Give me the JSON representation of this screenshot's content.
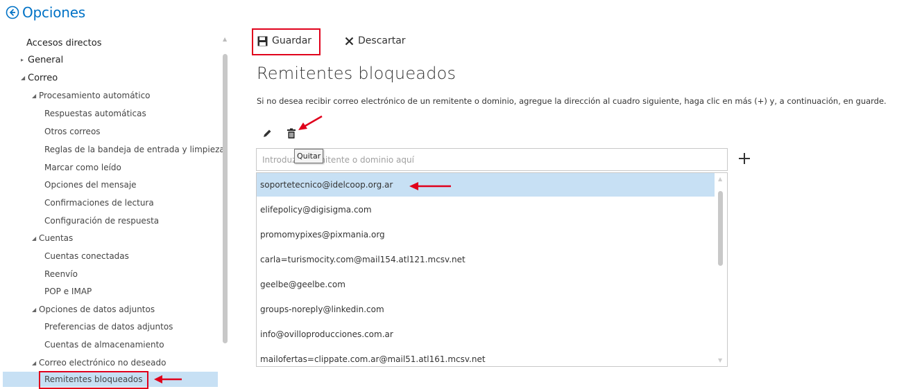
{
  "header": {
    "title": "Opciones",
    "back_icon": "back-arrow-circle-icon"
  },
  "sidebar": {
    "items": [
      {
        "label": "Accesos directos"
      },
      {
        "label": "General"
      },
      {
        "label": "Correo"
      },
      {
        "label": "Procesamiento automático"
      },
      {
        "label": "Respuestas automáticas"
      },
      {
        "label": "Otros correos"
      },
      {
        "label": "Reglas de la bandeja de entrada y limpieza"
      },
      {
        "label": "Marcar como leído"
      },
      {
        "label": "Opciones del mensaje"
      },
      {
        "label": "Confirmaciones de lectura"
      },
      {
        "label": "Configuración de respuesta"
      },
      {
        "label": "Cuentas"
      },
      {
        "label": "Cuentas conectadas"
      },
      {
        "label": "Reenvío"
      },
      {
        "label": "POP e IMAP"
      },
      {
        "label": "Opciones de datos adjuntos"
      },
      {
        "label": "Preferencias de datos adjuntos"
      },
      {
        "label": "Cuentas de almacenamiento"
      },
      {
        "label": "Correo electrónico no deseado"
      },
      {
        "label": "Remitentes bloqueados"
      }
    ],
    "selected": "Remitentes bloqueados"
  },
  "toolbar": {
    "save_label": "Guardar",
    "discard_label": "Descartar"
  },
  "main": {
    "title": "Remitentes bloqueados",
    "description": "Si no desea recibir correo electrónico de un remitente o dominio, agregue la dirección al cuadro siguiente, haga clic en más (+) y, a continuación, en guarde.",
    "input_placeholder": "Introduzca remitente o dominio aquí",
    "tooltip": "Quitar",
    "blocked_senders": [
      "soportetecnico@idelcoop.org.ar",
      "elifepolicy@digisigma.com",
      "promomypixes@pixmania.org",
      "carla=turismocity.com@mail154.atl121.mcsv.net",
      "geelbe@geelbe.com",
      "groups-noreply@linkedin.com",
      "info@ovilloproducciones.com.ar",
      "mailofertas=clippate.com.ar@mail51.atl161.mcsv.net"
    ],
    "selected_sender": "soportetecnico@idelcoop.org.ar"
  },
  "colors": {
    "accent": "#0072c6",
    "selection": "#c7e0f4",
    "highlight_red": "#e0001b"
  }
}
